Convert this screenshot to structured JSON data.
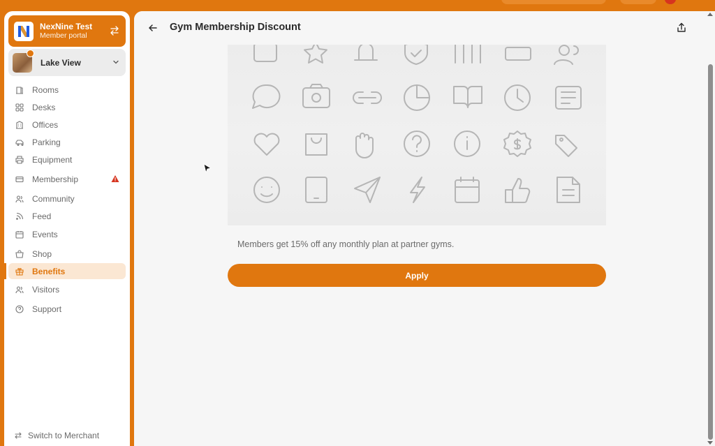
{
  "org": {
    "name": "NexNine Test",
    "subtitle": "Member portal"
  },
  "location": {
    "name": "Lake View"
  },
  "sidebar": {
    "items": [
      {
        "label": "Rooms",
        "icon": "rooms-icon"
      },
      {
        "label": "Desks",
        "icon": "desks-icon"
      },
      {
        "label": "Offices",
        "icon": "offices-icon"
      },
      {
        "label": "Parking",
        "icon": "car-icon"
      },
      {
        "label": "Equipment",
        "icon": "printer-icon"
      },
      {
        "label": "Membership",
        "icon": "card-icon",
        "alert": true
      },
      {
        "label": "Community",
        "icon": "users-icon"
      },
      {
        "label": "Feed",
        "icon": "rss-icon"
      },
      {
        "label": "Events",
        "icon": "calendar-icon"
      },
      {
        "label": "Shop",
        "icon": "shop-icon"
      },
      {
        "label": "Benefits",
        "icon": "gift-icon",
        "active": true
      },
      {
        "label": "Visitors",
        "icon": "visitors-icon"
      },
      {
        "label": "Support",
        "icon": "help-icon"
      }
    ],
    "footer": "Switch to Merchant"
  },
  "page": {
    "title": "Gym Membership Discount",
    "description": "Members get 15% off any monthly plan at partner gyms.",
    "apply_label": "Apply"
  },
  "colors": {
    "accent": "#e0770f",
    "alert": "#d6341f"
  }
}
